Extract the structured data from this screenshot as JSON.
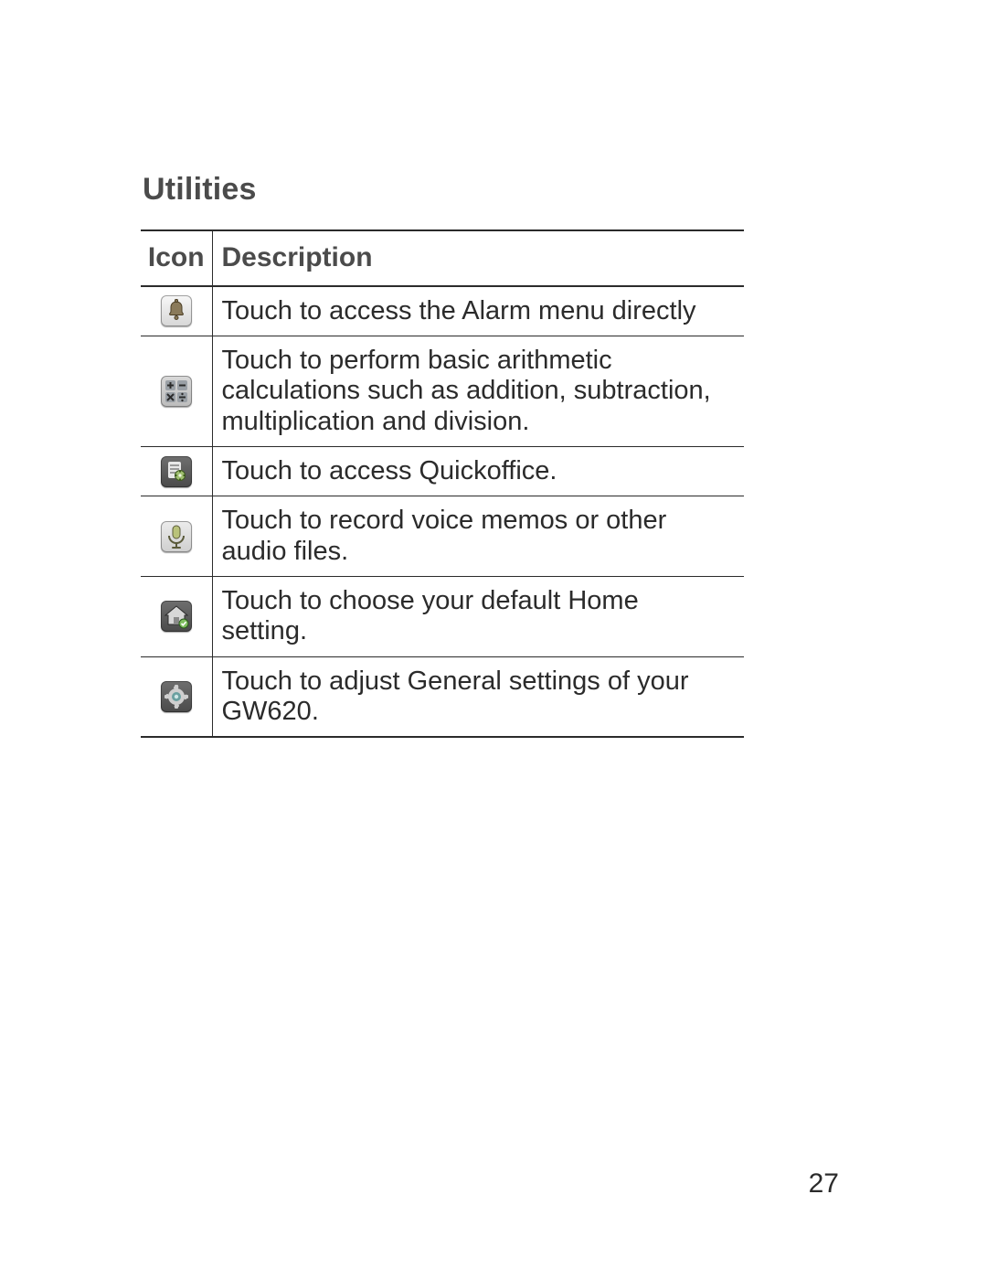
{
  "section_title": "Utilities",
  "headers": {
    "icon": "Icon",
    "description": "Description"
  },
  "rows": [
    {
      "icon_name": "alarm-icon",
      "description": "Touch to access the Alarm menu directly"
    },
    {
      "icon_name": "calculator-icon",
      "description": "Touch to perform basic arithmetic calculations such as addition, subtraction, multiplication and division."
    },
    {
      "icon_name": "quickoffice-icon",
      "description": "Touch to access Quickoffice."
    },
    {
      "icon_name": "voice-memo-icon",
      "description": "Touch to record voice memos or other audio files."
    },
    {
      "icon_name": "home-default-icon",
      "description": "Touch to choose your default Home setting."
    },
    {
      "icon_name": "settings-icon",
      "description": "Touch to adjust General settings of your GW620."
    }
  ],
  "page_number": "27"
}
